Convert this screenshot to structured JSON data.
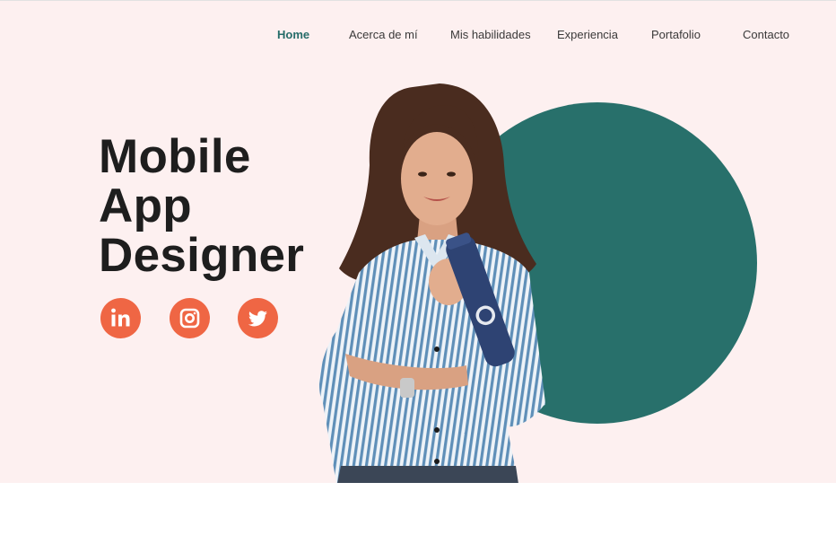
{
  "nav": {
    "items": [
      {
        "label": "Home",
        "active": true
      },
      {
        "label": "Acerca de mí",
        "active": false
      },
      {
        "label": "Mis habilidades",
        "active": false
      },
      {
        "label": "Experiencia",
        "active": false
      },
      {
        "label": "Portafolio",
        "active": false
      },
      {
        "label": "Contacto",
        "active": false
      }
    ]
  },
  "hero": {
    "title_lines": [
      "Mobile",
      "App",
      "Designer"
    ]
  },
  "social": [
    {
      "icon": "linkedin-icon"
    },
    {
      "icon": "instagram-icon"
    },
    {
      "icon": "twitter-icon"
    }
  ],
  "colors": {
    "hero_background": "#fdf0f0",
    "accent_teal": "#28706b",
    "active_nav": "#256c69",
    "social_orange": "#ef6644",
    "headline": "#1e1e1e"
  }
}
